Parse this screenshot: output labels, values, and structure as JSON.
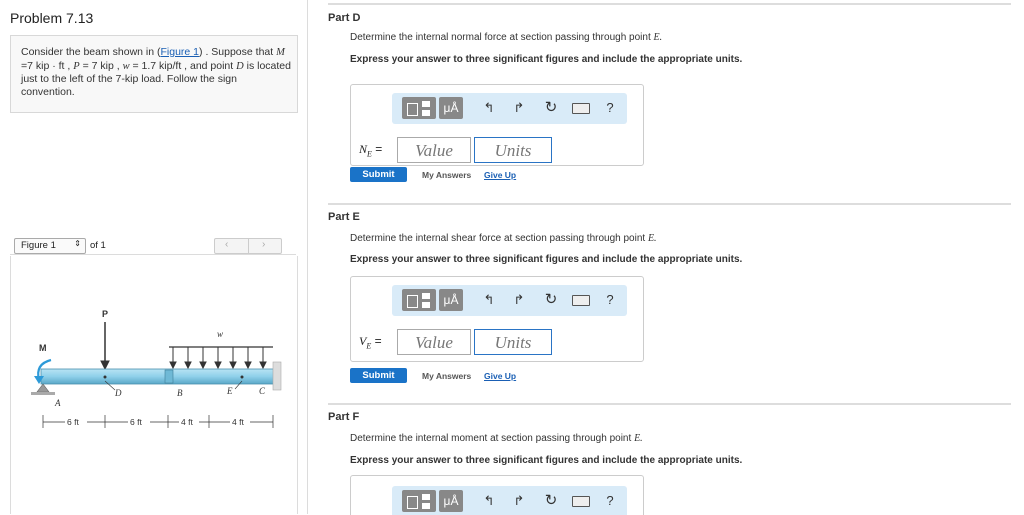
{
  "problem": {
    "title": "Problem 7.13",
    "text_parts": {
      "p1": "Consider the beam shown in (",
      "figure_link": "Figure 1",
      "p2": ") . Suppose that ",
      "M_sym": "M",
      "p3": " =7 kip · ft , ",
      "P_sym": "P",
      "p4": " = 7 kip , ",
      "w_sym": "w",
      "p5": " = 1.7 kip/ft , and point ",
      "D_sym": "D",
      "p6": " is located just to the left of the 7-kip load. Follow the sign convention."
    }
  },
  "figure_nav": {
    "select_value": "Figure 1",
    "of_label": "of 1"
  },
  "figure": {
    "P": "P",
    "w": "w",
    "M": "M",
    "A": "A",
    "B": "B",
    "C": "C",
    "D": "D",
    "E": "E",
    "dims": [
      "6 ft",
      "6 ft",
      "4 ft",
      "4 ft"
    ]
  },
  "parts": [
    {
      "title": "Part D",
      "question": "Determine the internal normal force at section passing through point",
      "point": "E.",
      "instruction": "Express your answer to three significant figures and include the appropriate units.",
      "var": "N",
      "sub": "E",
      "eq": "=",
      "value_placeholder": "Value",
      "units_placeholder": "Units",
      "submit": "Submit",
      "my_answers": "My Answers",
      "give_up": "Give Up"
    },
    {
      "title": "Part E",
      "question": "Determine the internal shear force at section passing through point",
      "point": "E.",
      "instruction": "Express your answer to three significant figures and include the appropriate units.",
      "var": "V",
      "sub": "E",
      "eq": "=",
      "value_placeholder": "Value",
      "units_placeholder": "Units",
      "submit": "Submit",
      "my_answers": "My Answers",
      "give_up": "Give Up"
    },
    {
      "title": "Part F",
      "question": "Determine the internal moment at section passing through point",
      "point": "E.",
      "instruction": "Express your answer to three significant figures and include the appropriate units."
    }
  ],
  "toolbar": {
    "mu": "μÅ",
    "undo": "↰",
    "redo": "↱",
    "reset": "↻",
    "help": "?"
  },
  "colors": {
    "accent": "#1a73c8",
    "toolbar_bg": "#d9ebf8",
    "beam": "#8fd0ea",
    "moment_arrow": "#2d9ad8"
  }
}
